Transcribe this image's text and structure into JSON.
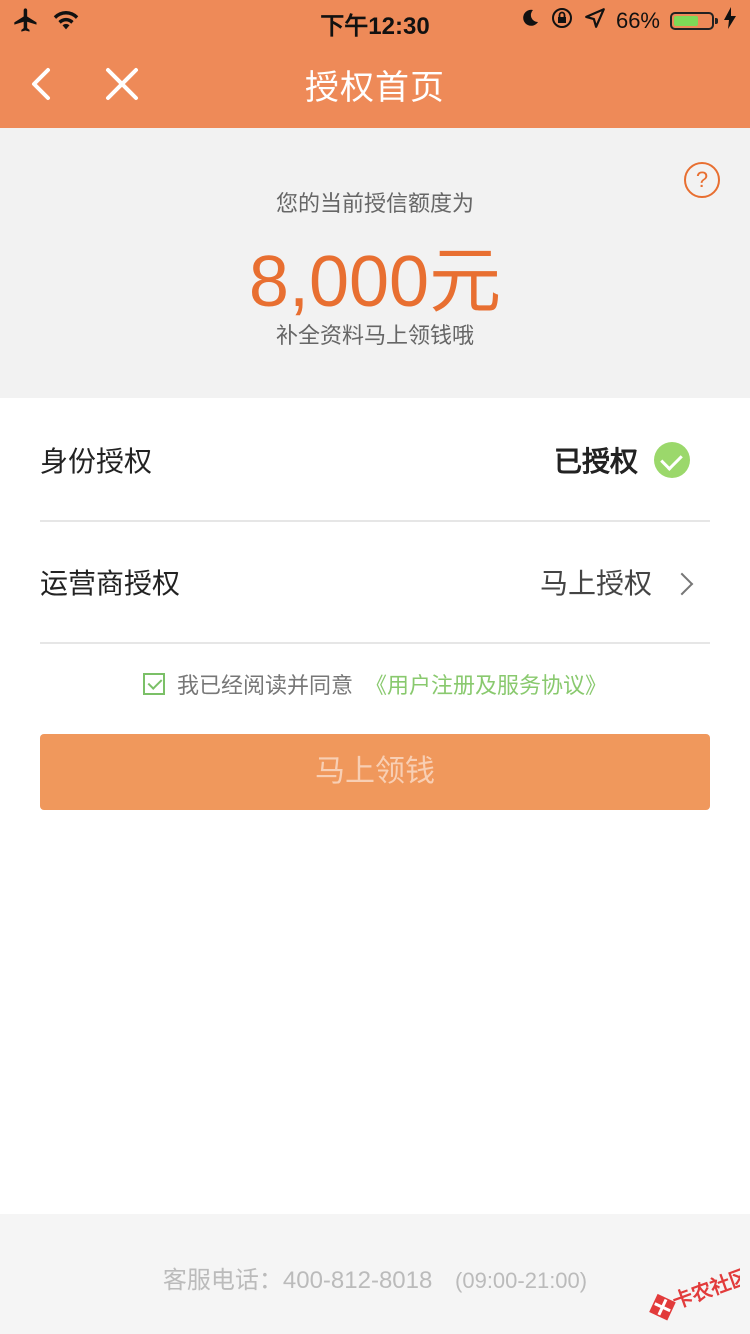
{
  "status_bar": {
    "time": "下午12:30",
    "battery_percent": "66%",
    "battery_level": 0.66,
    "icons": [
      "airplane-icon",
      "wifi-icon",
      "moon-icon",
      "orientation-lock-icon",
      "location-icon",
      "charging-icon"
    ]
  },
  "navbar": {
    "title": "授权首页",
    "back_icon": "chevron-left-icon",
    "close_icon": "close-icon",
    "bg_color": "#ee8a58"
  },
  "credit": {
    "label": "您的当前授信额度为",
    "amount": "8,000元",
    "subtitle": "补全资料马上领钱哦",
    "help_symbol": "?",
    "amount_color": "#e86f31"
  },
  "auth_rows": [
    {
      "label": "身份授权",
      "status": "已授权"
    },
    {
      "label": "运营商授权",
      "status": "马上授权"
    }
  ],
  "agreement": {
    "checked": true,
    "text": "我已经阅读并同意",
    "link": "《用户注册及服务协议》"
  },
  "submit_button": {
    "label": "马上领钱"
  },
  "footer": {
    "hotline": "客服电话：400-812-8018",
    "hours": "(09:00-21:00)"
  },
  "watermark": {
    "text": "卡农社区"
  }
}
